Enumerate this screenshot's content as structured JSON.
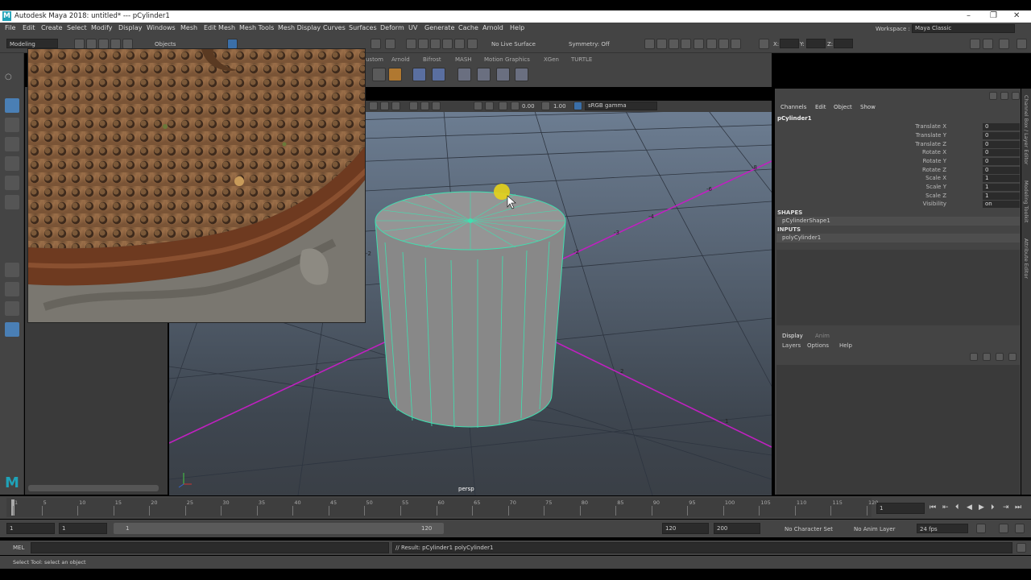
{
  "window": {
    "title": "Autodesk Maya 2018: untitled*   ---   pCylinder1",
    "logo_letter": "M",
    "controls": [
      "–",
      "❐",
      "✕"
    ]
  },
  "menus": [
    "File",
    "Edit",
    "Create",
    "Select",
    "Modify",
    "Display",
    "Windows",
    "Mesh",
    "Edit Mesh",
    "Mesh Tools",
    "Mesh Display",
    "Curves",
    "Surfaces",
    "Deform",
    "UV",
    "Generate",
    "Cache",
    "Arnold",
    "Help"
  ],
  "workspace": {
    "label": "Workspace :",
    "value": "Maya Classic"
  },
  "status_line": {
    "menuset": "Modeling",
    "objects_label": "Objects",
    "live_surface": "No Live Surface",
    "symmetry": "Symmetry: Off",
    "x_label": "X:",
    "y_label": "Y:",
    "z_label": "Z:"
  },
  "shelf_tabs": [
    "ustom",
    "Arnold",
    "Bifrost",
    "MASH",
    "Motion Graphics",
    "XGen",
    "TURTLE"
  ],
  "viewport": {
    "exposure": "0.00",
    "gamma": "1.00",
    "color_space": "sRGB gamma",
    "camera_label": "persp",
    "grid_numbers": [
      "-8",
      "-6",
      "-4",
      "-3",
      "-2",
      "2",
      "2",
      "-2",
      "1"
    ]
  },
  "channel_box": {
    "menu": [
      "Channels",
      "Edit",
      "Object",
      "Show"
    ],
    "object_name": "pCylinder1",
    "attributes": [
      {
        "label": "Translate X",
        "value": "0"
      },
      {
        "label": "Translate Y",
        "value": "0"
      },
      {
        "label": "Translate Z",
        "value": "0"
      },
      {
        "label": "Rotate X",
        "value": "0"
      },
      {
        "label": "Rotate Y",
        "value": "0"
      },
      {
        "label": "Rotate Z",
        "value": "0"
      },
      {
        "label": "Scale X",
        "value": "1"
      },
      {
        "label": "Scale Y",
        "value": "1"
      },
      {
        "label": "Scale Z",
        "value": "1"
      },
      {
        "label": "Visibility",
        "value": "on"
      }
    ],
    "shapes_header": "SHAPES",
    "shape_name": "pCylinderShape1",
    "inputs_header": "INPUTS",
    "input_name": "polyCylinder1"
  },
  "layer_editor": {
    "tabs": [
      "Display",
      "Anim"
    ],
    "menu": [
      "Layers",
      "Options",
      "Help"
    ]
  },
  "side_tabs": [
    "Channel Box / Layer Editor",
    "Modeling Toolkit",
    "Attribute Editor"
  ],
  "timeline": {
    "ticks": [
      "1",
      "5",
      "10",
      "15",
      "20",
      "25",
      "30",
      "35",
      "40",
      "45",
      "50",
      "55",
      "60",
      "65",
      "70",
      "75",
      "80",
      "85",
      "90",
      "95",
      "100",
      "105",
      "110",
      "115",
      "120"
    ],
    "current_frame": "1"
  },
  "range": {
    "start": "1",
    "playback_start": "1",
    "slider_start": "1",
    "slider_end": "120",
    "playback_end": "120",
    "end": "200",
    "character_set": "No Character Set",
    "anim_layer": "No Anim Layer",
    "fps": "24 fps"
  },
  "command_line": {
    "lang": "MEL",
    "result": "// Result: pCylinder1 polyCylinder1"
  },
  "help_line": "Select Tool: select an object",
  "colors": {
    "ui_bg": "#444444",
    "accent": "#4a7fb5",
    "wireframe_highlight": "#3fe0b0",
    "axis_magenta": "#c020c0",
    "maya_logo": "#1fa2b8"
  }
}
